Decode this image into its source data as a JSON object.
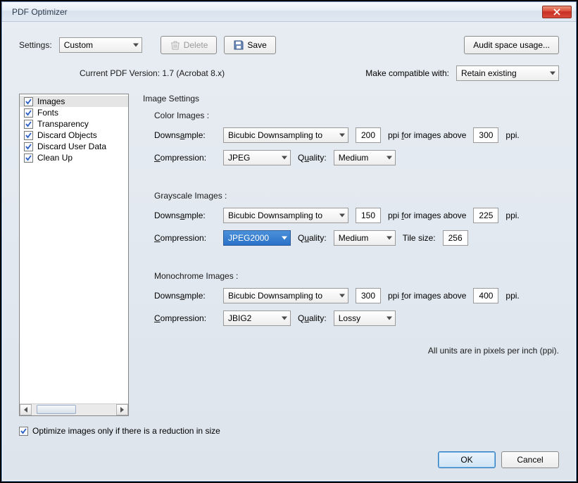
{
  "title": "PDF Optimizer",
  "top": {
    "settings_label": "Settings:",
    "settings_value": "Custom",
    "delete_label": "Delete",
    "save_label": "Save",
    "audit_label": "Audit space usage..."
  },
  "version": {
    "current": "Current PDF Version: 1.7 (Acrobat 8.x)",
    "compat_label": "Make compatible with:",
    "compat_value": "Retain existing"
  },
  "sidebar": {
    "items": [
      {
        "label": "Images"
      },
      {
        "label": "Fonts"
      },
      {
        "label": "Transparency"
      },
      {
        "label": "Discard Objects"
      },
      {
        "label": "Discard User Data"
      },
      {
        "label": "Clean Up"
      }
    ]
  },
  "panel": {
    "title": "Image Settings",
    "color": {
      "title": "Color Images :",
      "downsample_label_pre": "Downs",
      "downsample_label_u": "a",
      "downsample_label_post": "mple:",
      "downsample_value": "Bicubic Downsampling to",
      "ppi": "200",
      "for_label_pre": "ppi ",
      "for_label_u": "f",
      "for_label_post": "or images above",
      "above": "300",
      "ppi_suffix": "ppi.",
      "compression_label_u": "C",
      "compression_label_post": "ompression:",
      "compression_value": "JPEG",
      "quality_label_pre": "Q",
      "quality_label_u": "u",
      "quality_label_post": "ality:",
      "quality_value": "Medium"
    },
    "gray": {
      "title": "Grayscale Images :",
      "downsample_value": "Bicubic Downsampling to",
      "ppi": "150",
      "above": "225",
      "compression_value": "JPEG2000",
      "quality_value": "Medium",
      "tilesize_label": "Tile size:",
      "tilesize": "256"
    },
    "mono": {
      "title": "Monochrome Images :",
      "downsample_value": "Bicubic Downsampling to",
      "ppi": "300",
      "above": "400",
      "compression_value": "JBIG2",
      "quality_value": "Lossy"
    },
    "note": "All units are in pixels per inch (ppi)."
  },
  "optimize": {
    "label": "Optimize images only if there is a reduction in size"
  },
  "buttons": {
    "ok": "OK",
    "cancel": "Cancel"
  }
}
